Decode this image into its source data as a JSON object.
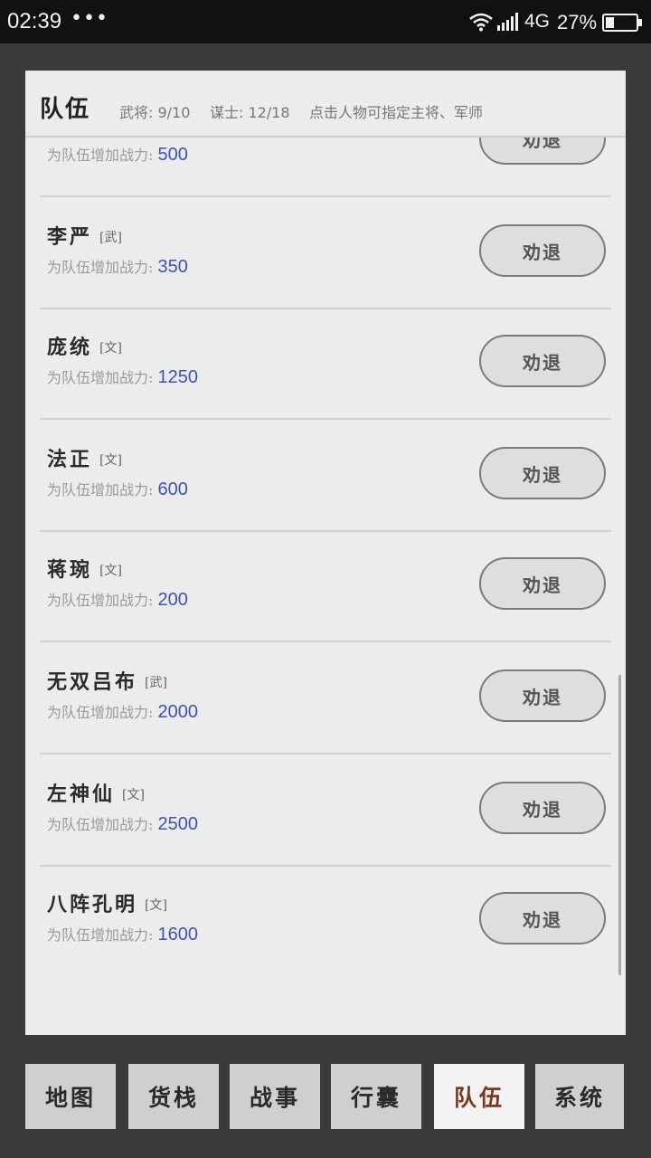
{
  "status_bar": {
    "time": "02:39",
    "dots": "•••",
    "network": "4G",
    "battery": "27%"
  },
  "panel": {
    "title": "队伍",
    "warriors": "武将: 9/10",
    "strategists": "谋士: 12/18",
    "hint": "点击人物可指定主将、军师"
  },
  "power_label": "为队伍增加战力:",
  "members": [
    {
      "name": "",
      "type": "",
      "power": "500",
      "button": "劝退"
    },
    {
      "name": "李严",
      "type": "[武]",
      "power": "350",
      "button": "劝退"
    },
    {
      "name": "庞统",
      "type": "[文]",
      "power": "1250",
      "button": "劝退"
    },
    {
      "name": "法正",
      "type": "[文]",
      "power": "600",
      "button": "劝退"
    },
    {
      "name": "蒋琬",
      "type": "[文]",
      "power": "200",
      "button": "劝退"
    },
    {
      "name": "无双吕布",
      "type": "[武]",
      "power": "2000",
      "button": "劝退"
    },
    {
      "name": "左神仙",
      "type": "[文]",
      "power": "2500",
      "button": "劝退"
    },
    {
      "name": "八阵孔明",
      "type": "[文]",
      "power": "1600",
      "button": "劝退"
    }
  ],
  "nav": [
    {
      "label": "地图",
      "active": false
    },
    {
      "label": "货栈",
      "active": false
    },
    {
      "label": "战事",
      "active": false
    },
    {
      "label": "行囊",
      "active": false
    },
    {
      "label": "队伍",
      "active": true
    },
    {
      "label": "系统",
      "active": false
    }
  ],
  "colors": {
    "power_value": "#3f52b8",
    "active_tab_text": "#7a3a22"
  }
}
